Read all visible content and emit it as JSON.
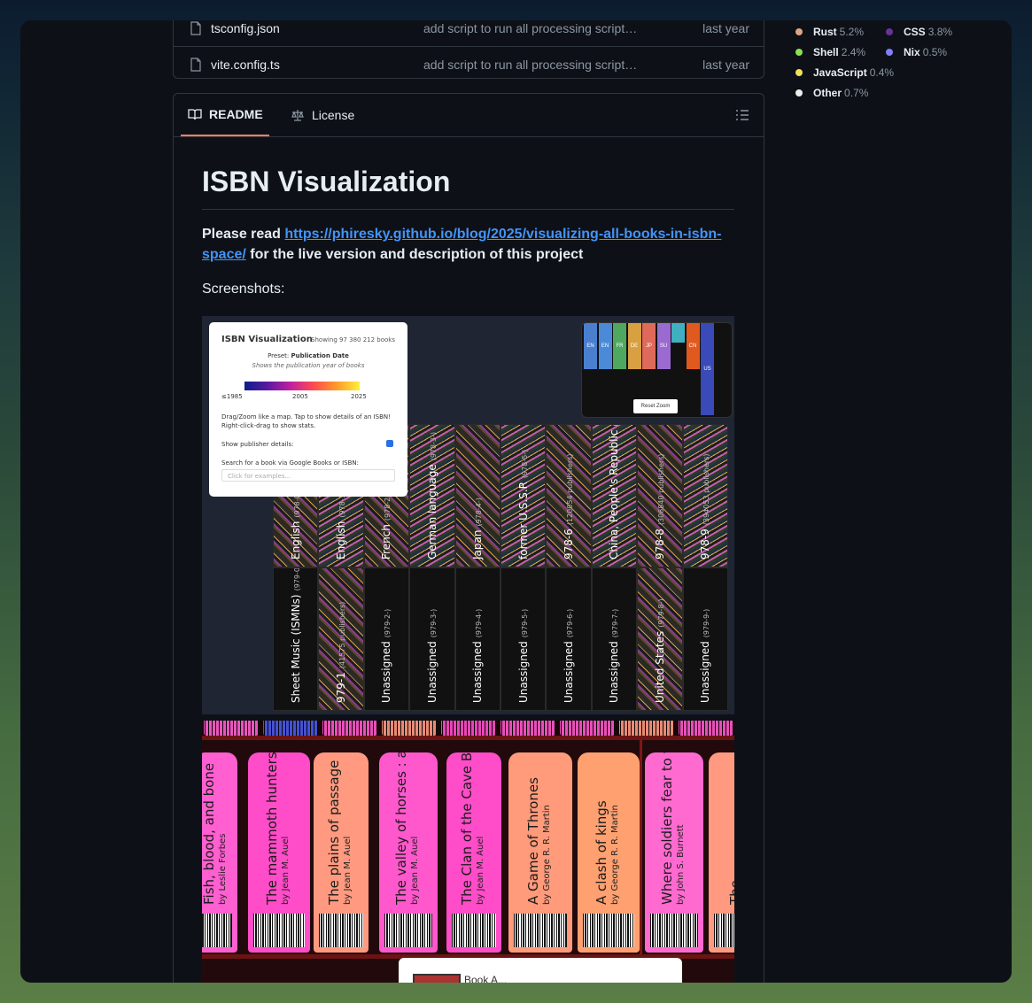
{
  "files": [
    {
      "name": "tsconfig.json",
      "message": "add script to run all processing script…",
      "date": "last year"
    },
    {
      "name": "vite.config.ts",
      "message": "add script to run all processing script…",
      "date": "last year"
    }
  ],
  "languages": [
    {
      "name": "Rust",
      "pct": "5.2%",
      "color": "#dea584"
    },
    {
      "name": "CSS",
      "pct": "3.8%",
      "color": "#663399"
    },
    {
      "name": "Shell",
      "pct": "2.4%",
      "color": "#89e051"
    },
    {
      "name": "Nix",
      "pct": "0.5%",
      "color": "#7e7eff"
    },
    {
      "name": "JavaScript",
      "pct": "0.4%",
      "color": "#f1e05a"
    },
    {
      "name": "Other",
      "pct": "0.7%",
      "color": "#ededed"
    }
  ],
  "readme": {
    "tabs": {
      "readme": "README",
      "license": "License"
    },
    "title": "ISBN Visualization",
    "intro_prefix": "Please read ",
    "intro_link": "https://phiresky.github.io/blog/2025/visualizing-all-books-in-isbn-space/",
    "intro_suffix": " for the live version and description of this project",
    "screenshots_label": "Screenshots:"
  },
  "screenshot1": {
    "panel": {
      "title": "ISBN Visualization",
      "count": "Showing 97 380 212 books",
      "preset_label": "Preset:",
      "preset_value": "Publication Date",
      "preset_desc": "Shows the publication year of books",
      "ticks": [
        "≤1985",
        "2005",
        "2025"
      ],
      "help": "Drag/Zoom like a map. Tap to show details of an ISBN! Right-click-drag to show stats.",
      "publisher_label": "Show publisher details:",
      "search_label": "Search for a book via Google Books or ISBN:",
      "search_placeholder": "Click for examples..."
    },
    "minimap": {
      "columns": [
        "EN",
        "EN",
        "FR",
        "DE",
        "JP",
        "SU",
        "",
        "CN",
        "US"
      ],
      "reset": "Reset Zoom"
    },
    "top_row": [
      {
        "label": "English",
        "sub": "(978-0)"
      },
      {
        "label": "English",
        "sub": "(978-1)"
      },
      {
        "label": "French",
        "sub": "(978-2)"
      },
      {
        "label": "German language",
        "sub": "(978-3-)"
      },
      {
        "label": "Japan",
        "sub": "(978-4-)"
      },
      {
        "label": "former U.S.S.R",
        "sub": "(978-5-)"
      },
      {
        "label": "978-6",
        "sub": "(120054 publishers)"
      },
      {
        "label": "China, People's Republic",
        "sub": "(978-7-)"
      },
      {
        "label": "978-8",
        "sub": "(306840 publishers)"
      },
      {
        "label": "978-9",
        "sub": "(394053 publishers)"
      }
    ],
    "bottom_row": [
      {
        "label": "Sheet Music (ISMNs)",
        "sub": "(979-0-)"
      },
      {
        "label": "979-1",
        "sub": "(41575 publishers)"
      },
      {
        "label": "Unassigned",
        "sub": "(979-2-)"
      },
      {
        "label": "Unassigned",
        "sub": "(979-3-)"
      },
      {
        "label": "Unassigned",
        "sub": "(979-4-)"
      },
      {
        "label": "Unassigned",
        "sub": "(979-5-)"
      },
      {
        "label": "Unassigned",
        "sub": "(979-6-)"
      },
      {
        "label": "Unassigned",
        "sub": "(979-7-)"
      },
      {
        "label": "United States",
        "sub": "(979-8-)"
      },
      {
        "label": "Unassigned",
        "sub": "(979-9-)"
      }
    ]
  },
  "screenshot2": {
    "books": [
      {
        "title": "Fish, blood, and bone",
        "author": "by Leslie Forbes",
        "color": "#ff5fd0"
      },
      {
        "title": "The mammoth hunters",
        "author": "by Jean M. Auel",
        "color": "#ff4cc8"
      },
      {
        "title": "The plains of passage",
        "author": "by Jean M. Auel",
        "color": "#ff9a80"
      },
      {
        "title": "The valley of horses : a novel",
        "author": "by Jean M. Auel",
        "color": "#ff58cc"
      },
      {
        "title": "The Clan of the Cave Bear : a novel",
        "author": "by Jean M. Auel",
        "color": "#ff4cc8"
      },
      {
        "title": "A Game of Thrones",
        "author": "by George R. R. Martin",
        "color": "#ff9a7a"
      },
      {
        "title": "A clash of kings",
        "author": "by George R. R. Martin",
        "color": "#ffa070"
      },
      {
        "title": "Where soldiers fear to tread : a relief worker's tale of survival",
        "author": "by John S. Burnett",
        "color": "#ff6ad0"
      },
      {
        "title": "The ...",
        "author": "",
        "color": "#ff9a80"
      }
    ],
    "card_text": "Book A..."
  }
}
